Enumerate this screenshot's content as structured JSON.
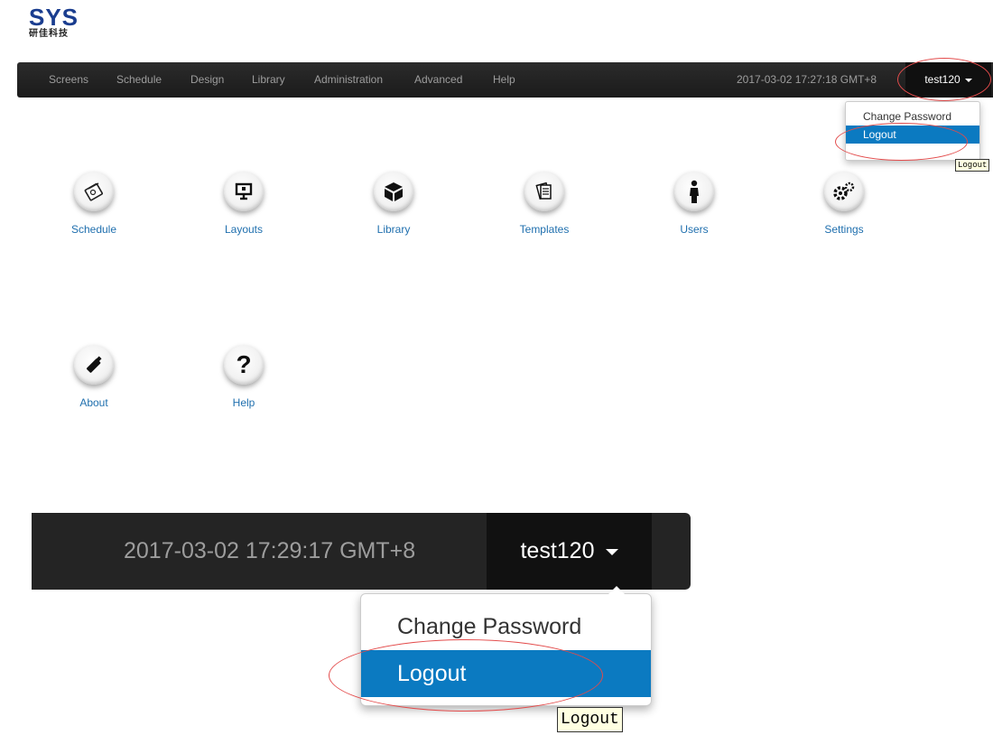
{
  "logo": {
    "mark": "SYS",
    "subtitle": "研佳科技"
  },
  "nav": {
    "items": [
      "Screens",
      "Schedule",
      "Design",
      "Library",
      "Administration",
      "Advanced",
      "Help"
    ],
    "clock": "2017-03-02 17:27:18 GMT+8",
    "user": "test120"
  },
  "user_menu": {
    "change_password": "Change Password",
    "logout": "Logout",
    "tooltip": "Logout"
  },
  "dashboard": {
    "tiles": [
      {
        "label": "Schedule",
        "icon": "calendar-icon"
      },
      {
        "label": "Layouts",
        "icon": "presentation-board-icon"
      },
      {
        "label": "Library",
        "icon": "box-icon"
      },
      {
        "label": "Templates",
        "icon": "documents-icon"
      },
      {
        "label": "Users",
        "icon": "person-icon"
      },
      {
        "label": "Settings",
        "icon": "gears-icon"
      },
      {
        "label": "About",
        "icon": "usb-drive-icon"
      },
      {
        "label": "Help",
        "icon": "question-mark-icon"
      }
    ]
  },
  "zoom": {
    "clock": "2017-03-02 17:29:17 GMT+8",
    "user": "test120",
    "change_password": "Change Password",
    "logout": "Logout",
    "tooltip": "Logout"
  },
  "colors": {
    "accent": "#0b7ac1",
    "link": "#1f6fae",
    "navbar": "#222222",
    "highlight_ring": "#e34b4b"
  }
}
